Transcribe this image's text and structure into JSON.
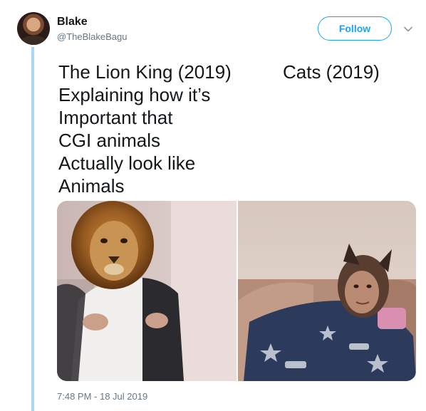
{
  "user": {
    "display_name": "Blake",
    "handle": "@TheBlakeBagu"
  },
  "actions": {
    "follow_label": "Follow",
    "more_icon": "chevron-down-icon"
  },
  "tweet": {
    "text_left": "The Lion King (2019)\nExplaining how it’s\nImportant that\nCGI animals\nActually look like\nAnimals",
    "text_right": "Cats (2019)",
    "timestamp": "7:48 PM - 18 Jul 2019"
  },
  "colors": {
    "accent": "#1da1f2",
    "thread_line": "#a9d8f5",
    "secondary_text": "#657786"
  }
}
